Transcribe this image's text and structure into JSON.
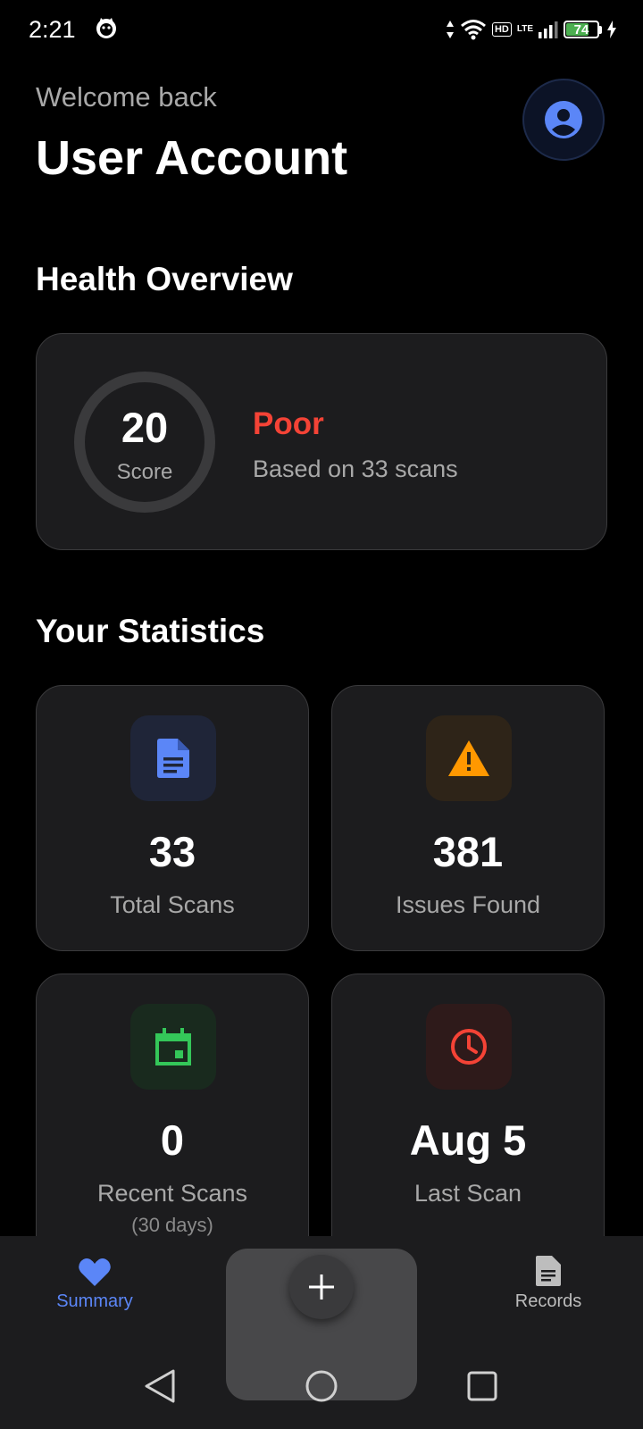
{
  "status_bar": {
    "time": "2:21",
    "network_badge": "HD",
    "network_type": "LTE",
    "battery_percent": 74
  },
  "header": {
    "welcome": "Welcome back",
    "title": "User Account",
    "avatar_icon": "account-circle-icon"
  },
  "health_overview": {
    "section_title": "Health Overview",
    "score_value": "20",
    "score_label": "Score",
    "status": "Poor",
    "status_color": "#f44336",
    "subtitle": "Based on 33 scans"
  },
  "statistics": {
    "section_title": "Your Statistics",
    "cards": [
      {
        "icon": "document-icon",
        "accent": "#5b86f7",
        "value": "33",
        "label": "Total Scans"
      },
      {
        "icon": "warning-icon",
        "accent": "#ff9800",
        "value": "381",
        "label": "Issues Found"
      },
      {
        "icon": "calendar-icon",
        "accent": "#34c759",
        "value": "0",
        "label": "Recent Scans",
        "sublabel": "(30 days)"
      },
      {
        "icon": "clock-icon",
        "accent": "#f44336",
        "value": "Aug 5",
        "label": "Last Scan"
      }
    ]
  },
  "bottom_nav": {
    "items": [
      {
        "label": "Summary",
        "icon": "heart-icon",
        "active": true
      },
      {
        "label": "Records",
        "icon": "document-icon",
        "active": false
      }
    ],
    "fab_icon": "plus-icon"
  },
  "colors": {
    "accent_blue": "#5b86f7",
    "background": "#000000",
    "card": "#1c1c1e"
  }
}
